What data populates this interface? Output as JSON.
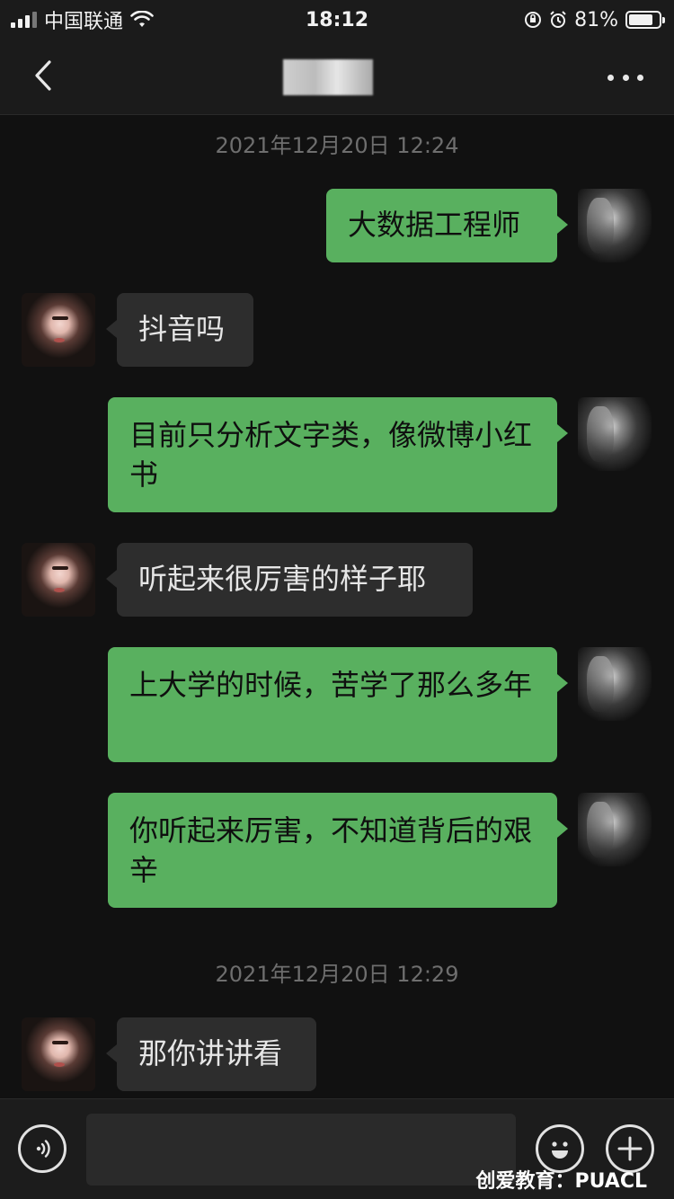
{
  "status_bar": {
    "carrier": "中国联通",
    "time": "18:12",
    "battery": "81%",
    "battery_level": 0.81
  },
  "nav": {
    "back_icon": "chevron-left-icon",
    "more_icon": "more-dots-icon"
  },
  "messages": {
    "ts1": "2021年12月20日 12:24",
    "m1": "大数据工程师",
    "m2": "抖音吗",
    "m3": "目前只分析文字类，像微博小红书",
    "m4": "听起来很厉害的样子耶",
    "m5": "上大学的时候，苦学了那么多年",
    "m6": "你听起来厉害，不知道背后的艰辛",
    "ts2": "2021年12月20日 12:29",
    "m7": "那你讲讲看"
  },
  "input_bar": {
    "voice_icon": "voice-icon",
    "emoji_icon": "emoji-icon",
    "plus_icon": "plus-icon",
    "watermark": "创爱教育：PUACL"
  },
  "colors": {
    "background": "#111111",
    "bubble_me": "#59b05f",
    "bubble_her": "#2d2d2d",
    "timestamp": "#6e6e6e"
  }
}
